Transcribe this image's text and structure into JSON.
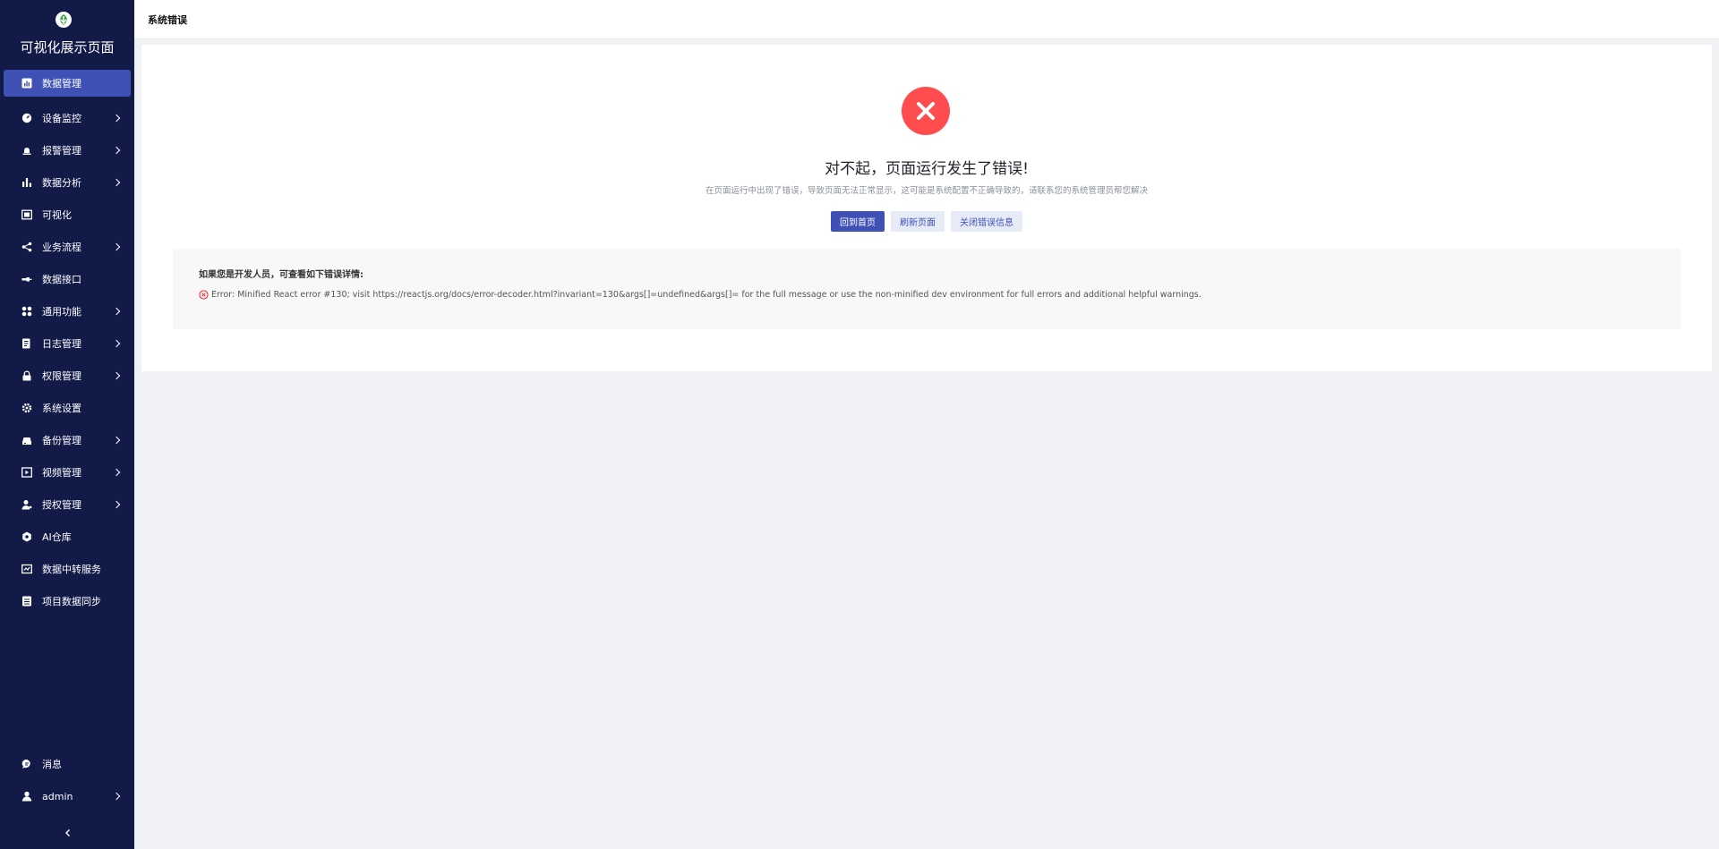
{
  "app": {
    "title": "可视化展示页面"
  },
  "sidebar": {
    "items": [
      {
        "label": "数据管理",
        "icon": "bar-chart-icon",
        "active": true,
        "has_submenu": false
      },
      {
        "label": "设备监控",
        "icon": "dashboard-icon",
        "active": false,
        "has_submenu": true
      },
      {
        "label": "报警管理",
        "icon": "alarm-icon",
        "active": false,
        "has_submenu": true
      },
      {
        "label": "数据分析",
        "icon": "bar-chart-icon",
        "active": false,
        "has_submenu": true
      },
      {
        "label": "可视化",
        "icon": "screen-icon",
        "active": false,
        "has_submenu": false
      },
      {
        "label": "业务流程",
        "icon": "share-icon",
        "active": false,
        "has_submenu": true
      },
      {
        "label": "数据接口",
        "icon": "api-icon",
        "active": false,
        "has_submenu": false
      },
      {
        "label": "通用功能",
        "icon": "apps-icon",
        "active": false,
        "has_submenu": true
      },
      {
        "label": "日志管理",
        "icon": "log-icon",
        "active": false,
        "has_submenu": true
      },
      {
        "label": "权限管理",
        "icon": "lock-icon",
        "active": false,
        "has_submenu": true
      },
      {
        "label": "系统设置",
        "icon": "gear-icon",
        "active": false,
        "has_submenu": false
      },
      {
        "label": "备份管理",
        "icon": "backup-icon",
        "active": false,
        "has_submenu": true
      },
      {
        "label": "视频管理",
        "icon": "video-icon",
        "active": false,
        "has_submenu": true
      },
      {
        "label": "授权管理",
        "icon": "user-key-icon",
        "active": false,
        "has_submenu": true
      },
      {
        "label": "AI仓库",
        "icon": "hexagon-icon",
        "active": false,
        "has_submenu": false
      },
      {
        "label": "数据中转服务",
        "icon": "transfer-icon",
        "active": false,
        "has_submenu": false
      },
      {
        "label": "项目数据同步",
        "icon": "sync-icon",
        "active": false,
        "has_submenu": false
      }
    ],
    "bottom": {
      "messages_label": "消息",
      "user_label": "admin"
    }
  },
  "header": {
    "breadcrumb": "系统错误"
  },
  "error_page": {
    "title": "对不起，页面运行发生了错误!",
    "description": "在页面运行中出现了错误，导致页面无法正常显示，这可能是系统配置不正确导致的，请联系您的系统管理员帮您解决",
    "buttons": {
      "home": "回到首页",
      "refresh": "刷新页面",
      "close": "关闭错误信息"
    },
    "developer": {
      "heading": "如果您是开发人员，可查看如下错误详情:",
      "error_text": "Error: Minified React error #130; visit https://reactjs.org/docs/error-decoder.html?invariant=130&args[]=undefined&args[]= for the full message or use the non-minified dev environment for full errors and additional helpful warnings."
    }
  },
  "colors": {
    "sidebar_bg": "#121a48",
    "accent": "#3f51b5",
    "error_red": "#ff4d4f",
    "page_bg": "#f0f2f5"
  }
}
